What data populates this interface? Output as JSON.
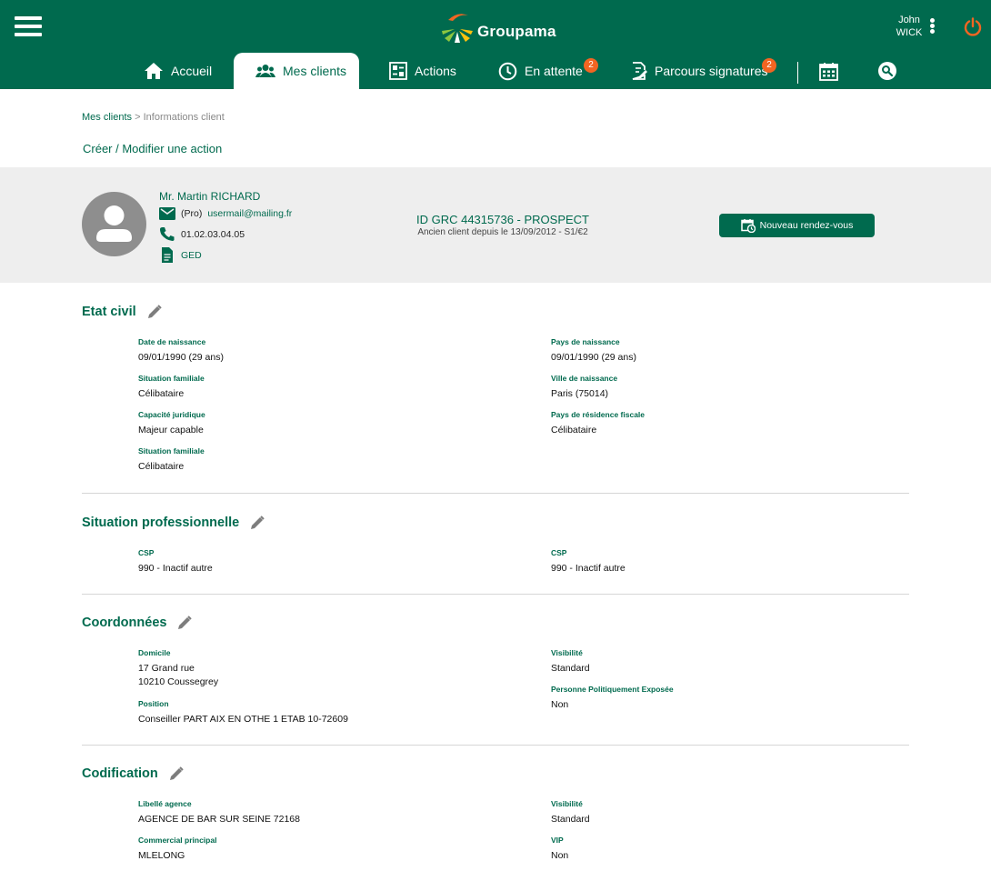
{
  "header": {
    "logo_text": "Groupama",
    "user_first": "John",
    "user_last": "WICK",
    "brand_color": "#006a4e",
    "accent_color": "#f26522"
  },
  "nav": {
    "items": [
      {
        "label": "Accueil",
        "icon": "home-icon"
      },
      {
        "label": "Mes clients",
        "icon": "clients-icon",
        "active": true
      },
      {
        "label": "Actions",
        "icon": "actions-icon"
      },
      {
        "label": "En attente",
        "icon": "clock-icon",
        "badge": "2"
      },
      {
        "label": "Parcours signatures",
        "icon": "signature-icon",
        "badge": "2"
      },
      {
        "label": "",
        "icon": "calendar-icon"
      },
      {
        "label": "",
        "icon": "search-icon"
      }
    ]
  },
  "breadcrumb": {
    "parent": "Mes clients",
    "separator": ">",
    "current": "Informations client"
  },
  "action_link": "Créer / Modifier une action",
  "client": {
    "name": "Mr. Martin RICHARD",
    "email_prefix": "(Pro)",
    "email": "usermail@mailing.fr",
    "phone": "01.02.03.04.05",
    "ged": "GED",
    "grc_id": "ID GRC 44315736 - PROSPECT",
    "since": "Ancien client depuis le 13/09/2012 - S1/€2",
    "rdv_button": "Nouveau rendez-vous"
  },
  "sections": {
    "etat_civil": {
      "title": "Etat civil",
      "left": [
        {
          "label": "Date de naissance",
          "value": "09/01/1990 (29 ans)"
        },
        {
          "label": "Situation familiale",
          "value": "Célibataire"
        },
        {
          "label": "Capacité juridique",
          "value": "Majeur capable"
        },
        {
          "label": "Situation familiale",
          "value": "Célibataire"
        }
      ],
      "right": [
        {
          "label": "Pays de naissance",
          "value": "09/01/1990 (29 ans)"
        },
        {
          "label": "Ville de naissance",
          "value": "Paris (75014)"
        },
        {
          "label": "Pays de résidence fiscale",
          "value": "Célibataire"
        }
      ]
    },
    "situation_pro": {
      "title": "Situation professionnelle",
      "left": [
        {
          "label": "CSP",
          "value": "990 - Inactif autre"
        }
      ],
      "right": [
        {
          "label": "CSP",
          "value": "990 - Inactif autre"
        }
      ]
    },
    "coordonnees": {
      "title": "Coordonnées",
      "left": [
        {
          "label": "Domicile",
          "value": "17 Grand rue",
          "value2": "10210 Coussegrey"
        },
        {
          "label": "Position",
          "value": "Conseiller PART AIX EN OTHE 1 ETAB 10-72609"
        }
      ],
      "right": [
        {
          "label": "Visibilité",
          "value": "Standard"
        },
        {
          "label": "Personne Politiquement Exposée",
          "value": "Non"
        }
      ]
    },
    "codification": {
      "title": "Codification",
      "left": [
        {
          "label": "Libellé agence",
          "value": "AGENCE DE BAR SUR SEINE 72168"
        },
        {
          "label": "Commercial principal",
          "value": "MLELONG"
        }
      ],
      "right": [
        {
          "label": "Visibilité",
          "value": "Standard"
        },
        {
          "label": "VIP",
          "value": "Non"
        }
      ]
    }
  }
}
